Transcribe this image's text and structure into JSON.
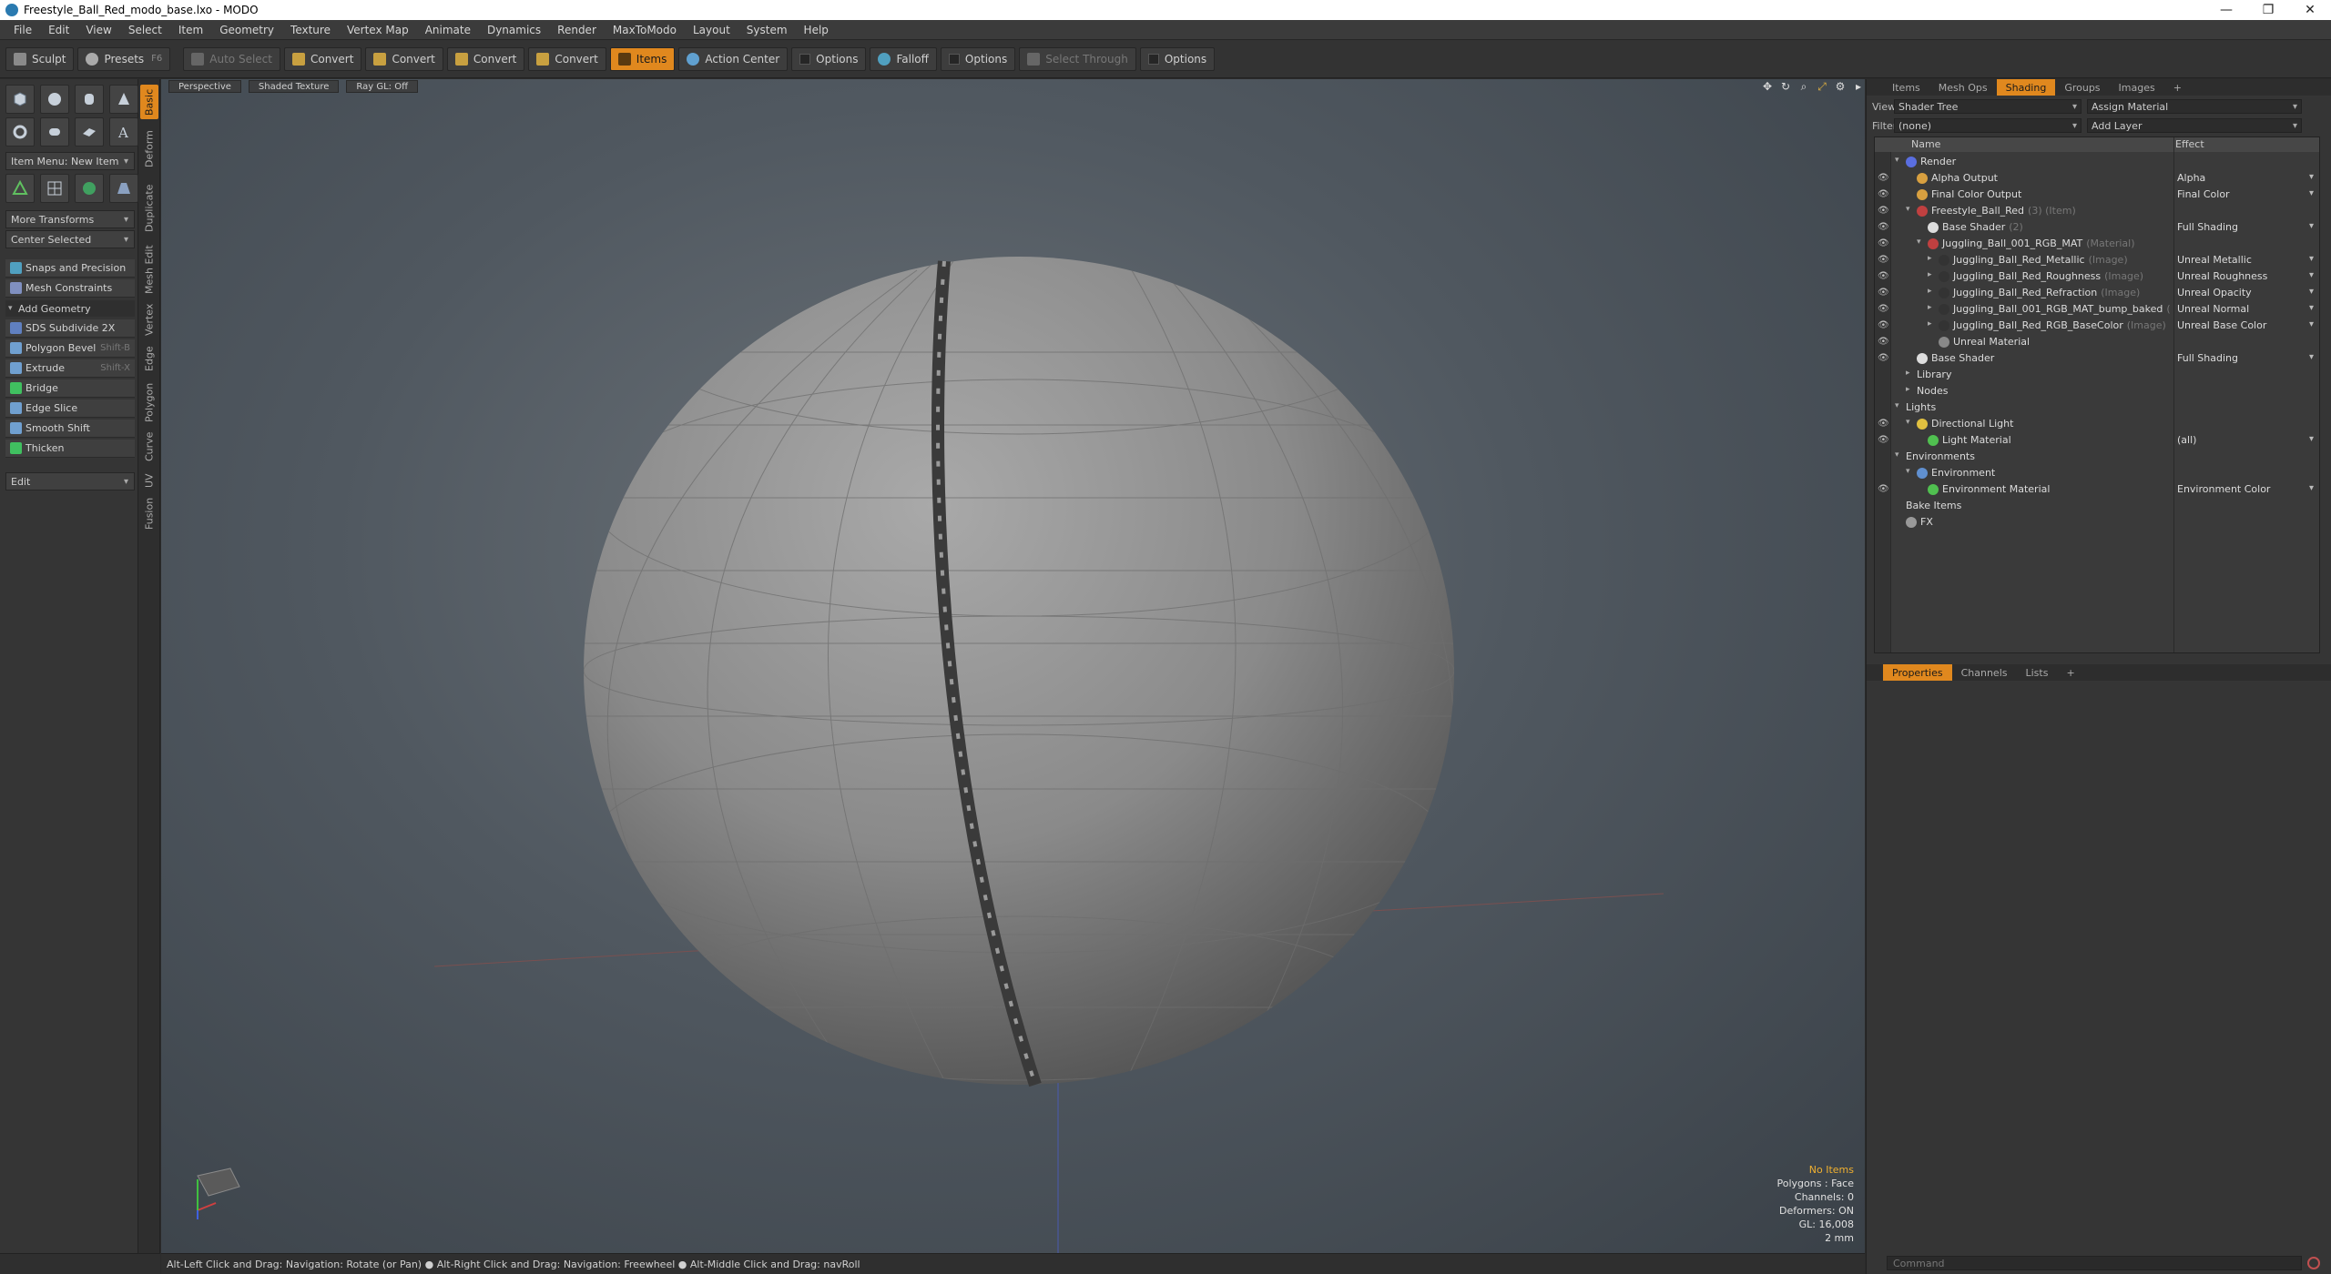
{
  "window": {
    "title": "Freestyle_Ball_Red_modo_base.lxo - MODO",
    "controls": [
      "—",
      "❐",
      "✕"
    ]
  },
  "menu": [
    "File",
    "Edit",
    "View",
    "Select",
    "Item",
    "Geometry",
    "Texture",
    "Vertex Map",
    "Animate",
    "Dynamics",
    "Render",
    "MaxToModo",
    "Layout",
    "System",
    "Help"
  ],
  "toolbar": {
    "sculpt": "Sculpt",
    "presets": "Presets",
    "presets_key": "F6",
    "auto_select": "Auto Select",
    "convert1": "Convert",
    "convert2": "Convert",
    "convert3": "Convert",
    "convert4": "Convert",
    "items": "Items",
    "action_center": "Action Center",
    "options1": "Options",
    "falloff": "Falloff",
    "options2": "Options",
    "select_through": "Select Through",
    "options3": "Options"
  },
  "left_panel": {
    "item_menu": "Item Menu: New Item",
    "more_transforms": "More Transforms",
    "center_selected": "Center Selected",
    "snaps": "Snaps and Precision",
    "mesh_constraints": "Mesh Constraints",
    "add_geometry": "Add Geometry",
    "tools": [
      {
        "label": "SDS Subdivide 2X",
        "shortcut": ""
      },
      {
        "label": "Polygon Bevel",
        "shortcut": "Shift-B"
      },
      {
        "label": "Extrude",
        "shortcut": "Shift-X"
      },
      {
        "label": "Bridge",
        "shortcut": ""
      },
      {
        "label": "Edge Slice",
        "shortcut": ""
      },
      {
        "label": "Smooth Shift",
        "shortcut": ""
      },
      {
        "label": "Thicken",
        "shortcut": ""
      }
    ],
    "edit": "Edit"
  },
  "side_tabs": [
    "Basic",
    "Deform",
    "Duplicate",
    "Mesh Edit",
    "Vertex",
    "Edge",
    "Polygon",
    "Curve",
    "UV",
    "Fusion"
  ],
  "viewport": {
    "perspective": "Perspective",
    "shaded_texture": "Shaded Texture",
    "ray_gl": "Ray GL: Off",
    "stats": {
      "no_items": "No Items",
      "polygons": "Polygons : Face",
      "channels": "Channels: 0",
      "deformers": "Deformers: ON",
      "gl": "GL: 16,008",
      "size": "2 mm"
    }
  },
  "status_bar": "Alt-Left Click and Drag: Navigation: Rotate (or Pan) ● Alt-Right Click and Drag: Navigation: Freewheel ● Alt-Middle Click and Drag: navRoll",
  "right_panel": {
    "tabs": [
      "Items",
      "Mesh Ops",
      "Shading",
      "Groups",
      "Images",
      "+"
    ],
    "view_label": "View",
    "view_value": "Shader Tree",
    "assign_material": "Assign Material",
    "filter_label": "Filter",
    "filter_value": "(none)",
    "add_layer": "Add Layer",
    "col_name": "Name",
    "col_effect": "Effect",
    "tree": [
      {
        "name": "Render",
        "suffix": "",
        "effect": "",
        "indent": 0,
        "eye": false,
        "twirl": "▾",
        "color": "#5a6ee0"
      },
      {
        "name": "Alpha Output",
        "suffix": "",
        "effect": "Alpha",
        "indent": 1,
        "eye": true,
        "twirl": "",
        "color": "#d8a040"
      },
      {
        "name": "Final Color Output",
        "suffix": "",
        "effect": "Final Color",
        "indent": 1,
        "eye": true,
        "twirl": "",
        "color": "#d8a040"
      },
      {
        "name": "Freestyle_Ball_Red",
        "suffix": "(3) (Item)",
        "effect": "",
        "indent": 1,
        "eye": true,
        "twirl": "▾",
        "color": "#c04040"
      },
      {
        "name": "Base Shader",
        "suffix": "(2)",
        "effect": "Full Shading",
        "indent": 2,
        "eye": true,
        "twirl": "",
        "color": "#dddddd"
      },
      {
        "name": "Juggling_Ball_001_RGB_MAT",
        "suffix": "(Material)",
        "effect": "",
        "indent": 2,
        "eye": true,
        "twirl": "▾",
        "color": "#c04040"
      },
      {
        "name": "Juggling_Ball_Red_Metallic",
        "suffix": "(Image)",
        "effect": "Unreal Metallic",
        "indent": 3,
        "eye": true,
        "twirl": "▸",
        "color": "#333333"
      },
      {
        "name": "Juggling_Ball_Red_Roughness",
        "suffix": "(Image)",
        "effect": "Unreal Roughness",
        "indent": 3,
        "eye": true,
        "twirl": "▸",
        "color": "#333333"
      },
      {
        "name": "Juggling_Ball_Red_Refraction",
        "suffix": "(Image)",
        "effect": "Unreal Opacity",
        "indent": 3,
        "eye": true,
        "twirl": "▸",
        "color": "#333333"
      },
      {
        "name": "Juggling_Ball_001_RGB_MAT_bump_baked",
        "suffix": "(",
        "effect": "Unreal Normal",
        "indent": 3,
        "eye": true,
        "twirl": "▸",
        "color": "#333333"
      },
      {
        "name": "Juggling_Ball_Red_RGB_BaseColor",
        "suffix": "(Image)",
        "effect": "Unreal Base Color",
        "indent": 3,
        "eye": true,
        "twirl": "▸",
        "color": "#333333"
      },
      {
        "name": "Unreal Material",
        "suffix": "",
        "effect": "",
        "indent": 3,
        "eye": true,
        "twirl": "",
        "color": "#888888"
      },
      {
        "name": "Base Shader",
        "suffix": "",
        "effect": "Full Shading",
        "indent": 1,
        "eye": true,
        "twirl": "",
        "color": "#dddddd"
      },
      {
        "name": "Library",
        "suffix": "",
        "effect": "",
        "indent": 1,
        "eye": false,
        "twirl": "▸",
        "color": ""
      },
      {
        "name": "Nodes",
        "suffix": "",
        "effect": "",
        "indent": 1,
        "eye": false,
        "twirl": "▸",
        "color": ""
      },
      {
        "name": "Lights",
        "suffix": "",
        "effect": "",
        "indent": 0,
        "eye": false,
        "twirl": "▾",
        "color": ""
      },
      {
        "name": "Directional Light",
        "suffix": "",
        "effect": "",
        "indent": 1,
        "eye": true,
        "twirl": "▾",
        "color": "#e0c040"
      },
      {
        "name": "Light Material",
        "suffix": "",
        "effect": "(all)",
        "indent": 2,
        "eye": true,
        "twirl": "",
        "color": "#50c050"
      },
      {
        "name": "Environments",
        "suffix": "",
        "effect": "",
        "indent": 0,
        "eye": false,
        "twirl": "▾",
        "color": ""
      },
      {
        "name": "Environment",
        "suffix": "",
        "effect": "",
        "indent": 1,
        "eye": false,
        "twirl": "▾",
        "color": "#6090d0"
      },
      {
        "name": "Environment Material",
        "suffix": "",
        "effect": "Environment Color",
        "indent": 2,
        "eye": true,
        "twirl": "",
        "color": "#50c050"
      },
      {
        "name": "Bake Items",
        "suffix": "",
        "effect": "",
        "indent": 0,
        "eye": false,
        "twirl": "",
        "color": ""
      },
      {
        "name": "FX",
        "suffix": "",
        "effect": "",
        "indent": 0,
        "eye": false,
        "twirl": "",
        "color": "#999999"
      }
    ],
    "prop_tabs": [
      "Properties",
      "Channels",
      "Lists",
      "+"
    ],
    "command_placeholder": "Command"
  }
}
